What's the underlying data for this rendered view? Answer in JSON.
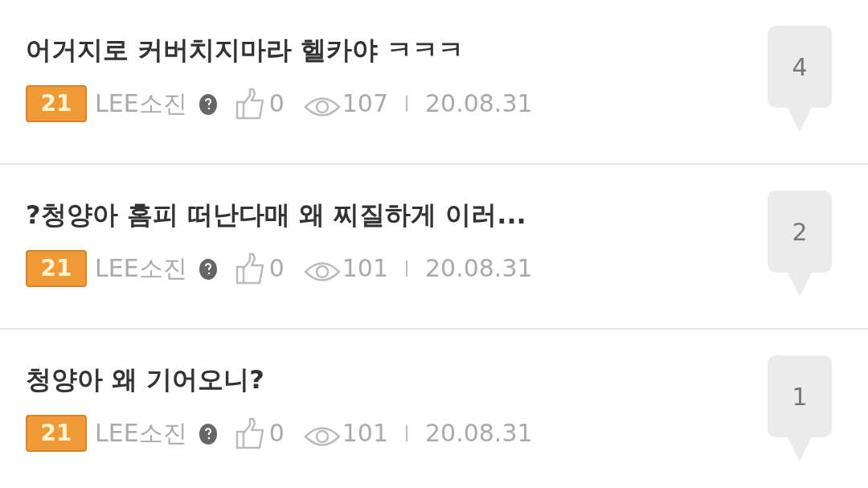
{
  "posts": [
    {
      "title": "어거지로 커버치지마라 헬카야 ㅋㅋㅋ",
      "level": "21",
      "author": "LEE소진",
      "likes": "0",
      "views": "107",
      "date": "20.08.31",
      "comments": "4"
    },
    {
      "title": "?청양아 홈피 떠난다매 왜 찌질하게 이러...",
      "level": "21",
      "author": "LEE소진",
      "likes": "0",
      "views": "101",
      "date": "20.08.31",
      "comments": "2"
    },
    {
      "title": "청양아 왜 기어오니?",
      "level": "21",
      "author": "LEE소진",
      "likes": "0",
      "views": "101",
      "date": "20.08.31",
      "comments": "1"
    }
  ]
}
